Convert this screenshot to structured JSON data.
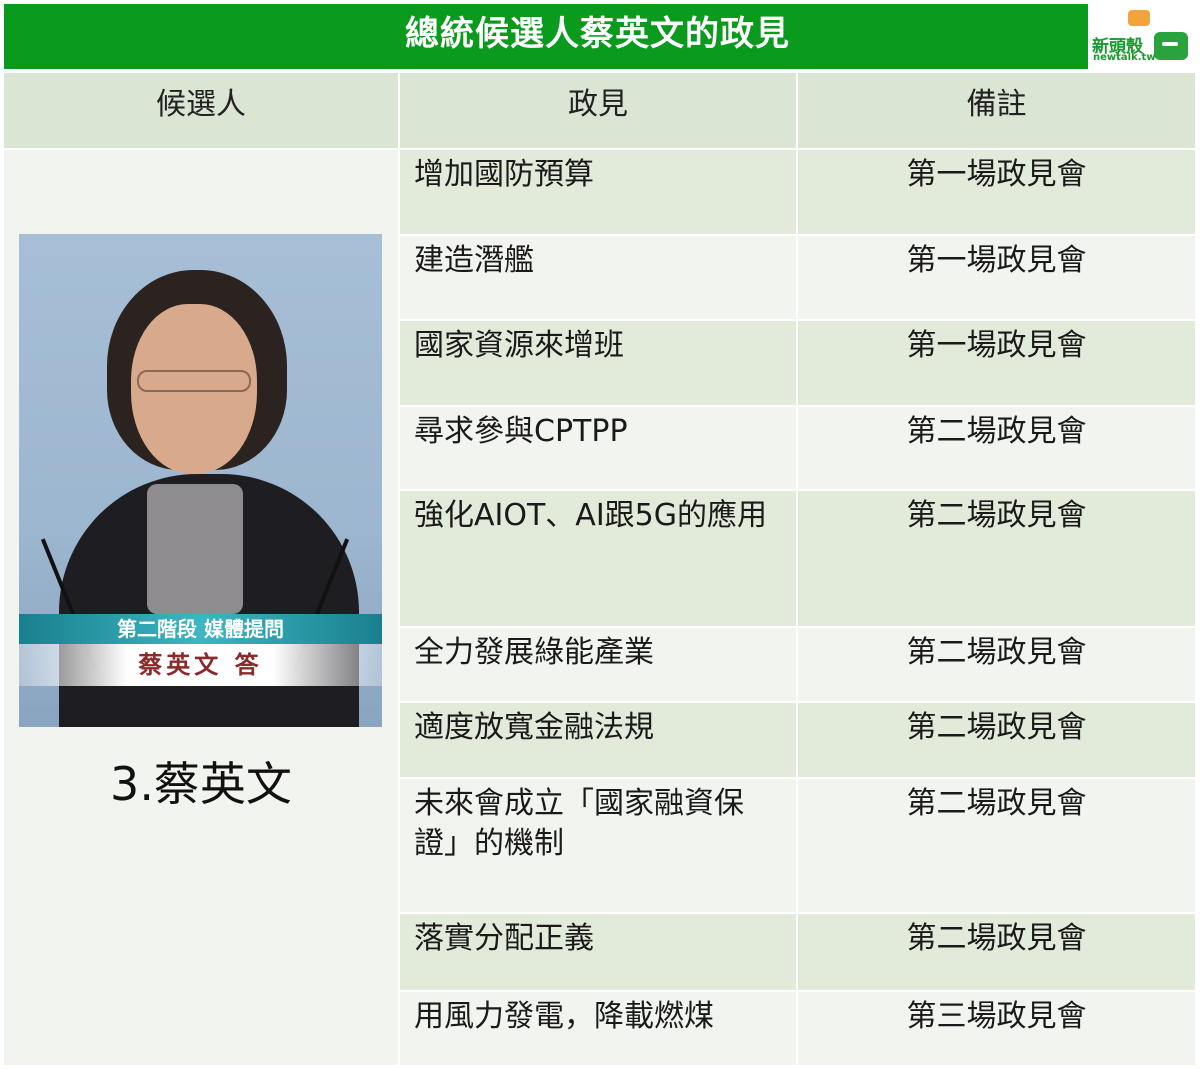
{
  "title": "總統候選人蔡英文的政見",
  "logo": {
    "name": "新頭殼",
    "sub": "newtalk.tw"
  },
  "headers": {
    "candidate": "候選人",
    "policy": "政見",
    "note": "備註"
  },
  "candidate": {
    "name": "3.蔡英文",
    "photo_ticker": "第二階段 媒體提問",
    "photo_caption": "蔡英文 答"
  },
  "rows": [
    {
      "policy": "增加國防預算",
      "note": "第一場政見會"
    },
    {
      "policy": "建造潛艦",
      "note": "第一場政見會"
    },
    {
      "policy": "國家資源來增班",
      "note": "第一場政見會"
    },
    {
      "policy": "尋求參與CPTPP",
      "note": "第二場政見會"
    },
    {
      "policy": "強化AIOT、AI跟5G的應用",
      "note": "第二場政見會"
    },
    {
      "policy": "全力發展綠能產業",
      "note": "第二場政見會"
    },
    {
      "policy": "適度放寬金融法規",
      "note": "第二場政見會"
    },
    {
      "policy": "未來會成立「國家融資保證」的機制",
      "note": "第二場政見會"
    },
    {
      "policy": "落實分配正義",
      "note": "第二場政見會"
    },
    {
      "policy": "用風力發電，降載燃煤",
      "note": "第三場政見會"
    }
  ]
}
